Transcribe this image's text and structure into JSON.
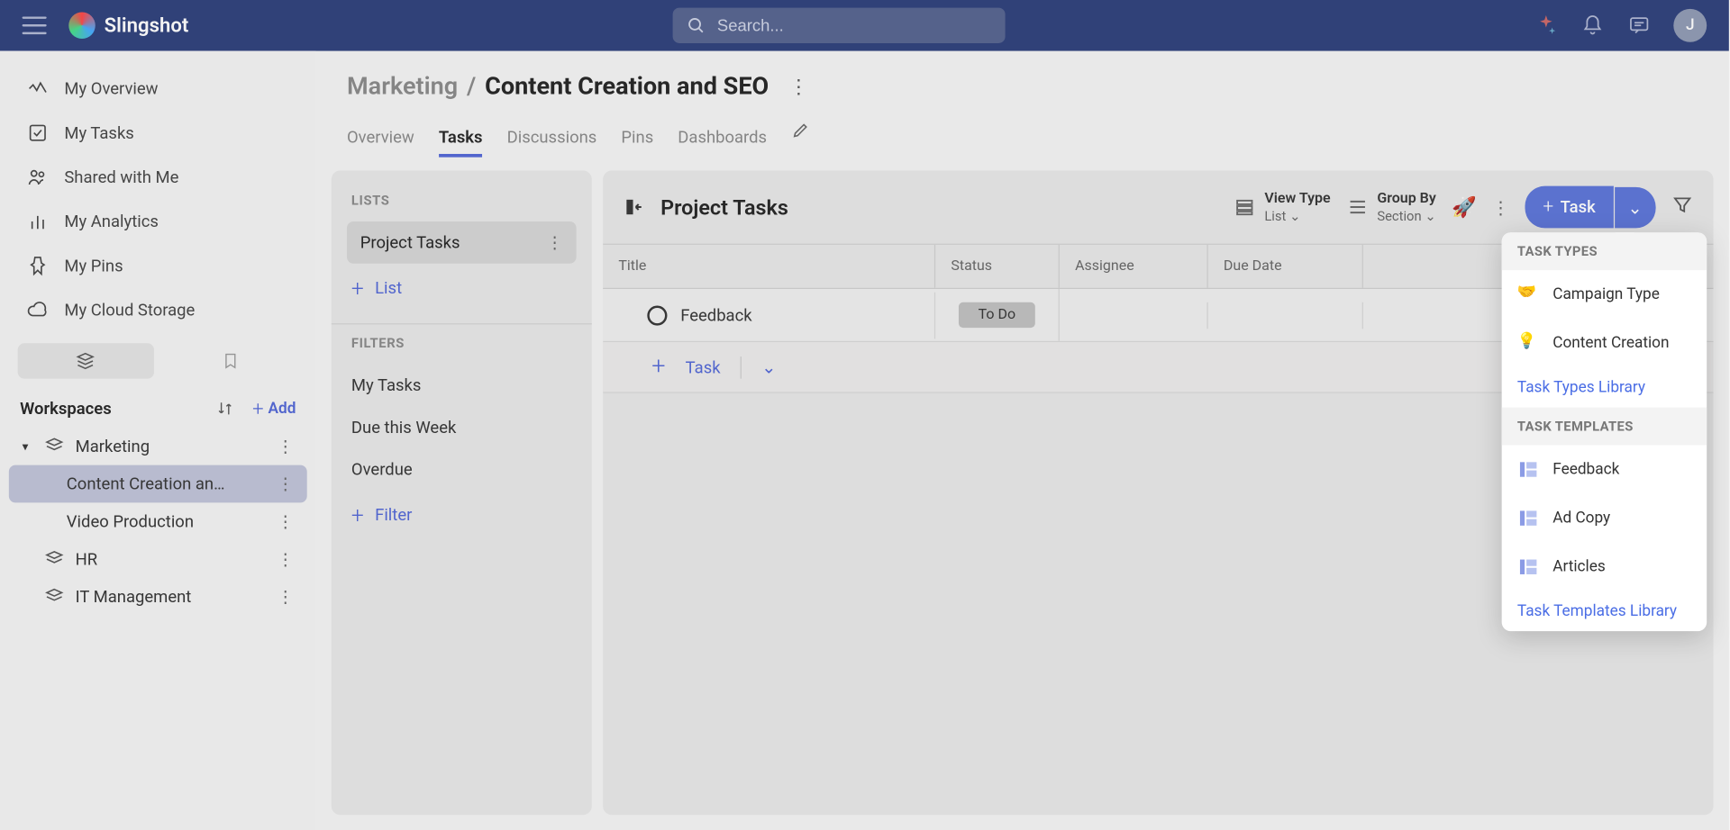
{
  "app": {
    "name": "Slingshot",
    "avatar_initial": "J"
  },
  "search": {
    "placeholder": "Search..."
  },
  "nav": {
    "overview": "My Overview",
    "tasks": "My Tasks",
    "shared": "Shared with Me",
    "analytics": "My Analytics",
    "pins": "My Pins",
    "cloud": "My Cloud Storage"
  },
  "workspaces": {
    "header": "Workspaces",
    "add_label": "Add",
    "items": [
      {
        "name": "Marketing",
        "expanded": true,
        "children": [
          {
            "name": "Content Creation an…",
            "active": true
          },
          {
            "name": "Video Production",
            "active": false
          }
        ]
      },
      {
        "name": "HR",
        "expanded": false
      },
      {
        "name": "IT Management",
        "expanded": false
      }
    ]
  },
  "breadcrumb": {
    "parent": "Marketing",
    "current": "Content Creation and SEO"
  },
  "tabs": [
    "Overview",
    "Tasks",
    "Discussions",
    "Pins",
    "Dashboards"
  ],
  "active_tab": "Tasks",
  "lists_panel": {
    "header": "LISTS",
    "list_name": "Project Tasks",
    "add_list": "List",
    "filters_header": "FILTERS",
    "filters": [
      "My Tasks",
      "Due this Week",
      "Overdue"
    ],
    "add_filter": "Filter"
  },
  "tasks_panel": {
    "title": "Project Tasks",
    "view_type_label": "View Type",
    "view_type_value": "List",
    "group_by_label": "Group By",
    "group_by_value": "Section",
    "task_button": "Task",
    "columns": {
      "title": "Title",
      "status": "Status",
      "assignee": "Assignee",
      "due": "Due Date"
    },
    "rows": [
      {
        "title": "Feedback",
        "status": "To Do",
        "assignee": "",
        "due": ""
      }
    ],
    "add_task_label": "Task"
  },
  "popover": {
    "types_header": "TASK TYPES",
    "types": [
      "Campaign Type",
      "Content Creation"
    ],
    "types_library": "Task Types Library",
    "templates_header": "TASK TEMPLATES",
    "templates": [
      "Feedback",
      "Ad Copy",
      "Articles"
    ],
    "templates_library": "Task Templates Library"
  }
}
